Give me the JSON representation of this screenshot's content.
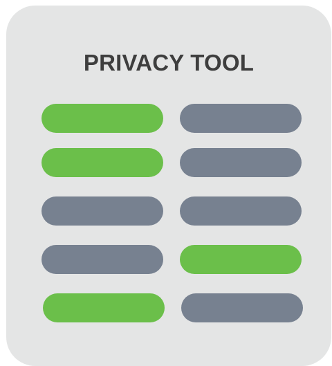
{
  "title": "PRIVACY TOOL",
  "colors": {
    "card_background": "#e4e5e5",
    "title_text": "#3e3e3e",
    "green": "#6bbf4a",
    "gray": "#778190"
  },
  "toggle_rows": [
    {
      "left": "green",
      "right": "gray"
    },
    {
      "left": "green",
      "right": "gray"
    },
    {
      "left": "gray",
      "right": "gray"
    },
    {
      "left": "gray",
      "right": "green"
    },
    {
      "left": "green",
      "right": "gray"
    }
  ]
}
